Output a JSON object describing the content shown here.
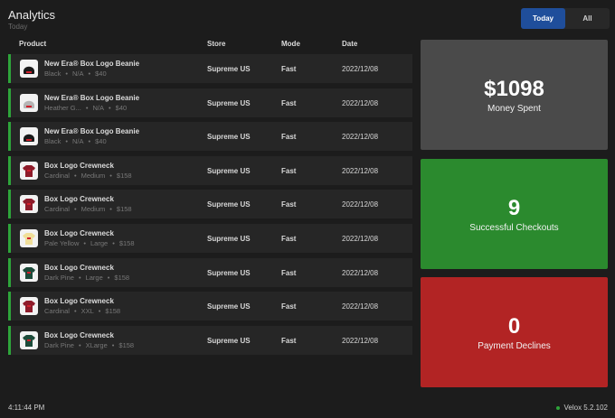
{
  "header": {
    "title": "Analytics",
    "subtitle": "Today"
  },
  "tabs": [
    {
      "label": "Today",
      "active": true
    },
    {
      "label": "All",
      "active": false
    }
  ],
  "table": {
    "columns": {
      "product": "Product",
      "store": "Store",
      "mode": "Mode",
      "date": "Date"
    },
    "rows": [
      {
        "name": "New Era® Box Logo Beanie",
        "color": "Black",
        "size": "N/A",
        "price": "$40",
        "store": "Supreme US",
        "mode": "Fast",
        "date": "2022/12/08",
        "icon": "beanie-icon",
        "swatch": "#1a1a1a"
      },
      {
        "name": "New Era® Box Logo Beanie",
        "color": "Heather G...",
        "size": "N/A",
        "price": "$40",
        "store": "Supreme US",
        "mode": "Fast",
        "date": "2022/12/08",
        "icon": "beanie-icon",
        "swatch": "#b5b5b5"
      },
      {
        "name": "New Era® Box Logo Beanie",
        "color": "Black",
        "size": "N/A",
        "price": "$40",
        "store": "Supreme US",
        "mode": "Fast",
        "date": "2022/12/08",
        "icon": "beanie-icon",
        "swatch": "#1a1a1a"
      },
      {
        "name": "Box Logo Crewneck",
        "color": "Cardinal",
        "size": "Medium",
        "price": "$158",
        "store": "Supreme US",
        "mode": "Fast",
        "date": "2022/12/08",
        "icon": "crewneck-icon",
        "swatch": "#8e1b2a"
      },
      {
        "name": "Box Logo Crewneck",
        "color": "Cardinal",
        "size": "Medium",
        "price": "$158",
        "store": "Supreme US",
        "mode": "Fast",
        "date": "2022/12/08",
        "icon": "crewneck-icon",
        "swatch": "#8e1b2a"
      },
      {
        "name": "Box Logo Crewneck",
        "color": "Pale Yellow",
        "size": "Large",
        "price": "$158",
        "store": "Supreme US",
        "mode": "Fast",
        "date": "2022/12/08",
        "icon": "crewneck-icon",
        "swatch": "#f0df9a"
      },
      {
        "name": "Box Logo Crewneck",
        "color": "Dark Pine",
        "size": "Large",
        "price": "$158",
        "store": "Supreme US",
        "mode": "Fast",
        "date": "2022/12/08",
        "icon": "crewneck-icon",
        "swatch": "#1d4b3a"
      },
      {
        "name": "Box Logo Crewneck",
        "color": "Cardinal",
        "size": "XXL",
        "price": "$158",
        "store": "Supreme US",
        "mode": "Fast",
        "date": "2022/12/08",
        "icon": "crewneck-icon",
        "swatch": "#8e1b2a"
      },
      {
        "name": "Box Logo Crewneck",
        "color": "Dark Pine",
        "size": "XLarge",
        "price": "$158",
        "store": "Supreme US",
        "mode": "Fast",
        "date": "2022/12/08",
        "icon": "crewneck-icon",
        "swatch": "#1d4b3a"
      }
    ]
  },
  "stats": [
    {
      "value": "$1098",
      "label": "Money Spent",
      "color": "#4a4a4a"
    },
    {
      "value": "9",
      "label": "Successful Checkouts",
      "color": "#2b8a2e"
    },
    {
      "value": "0",
      "label": "Payment Declines",
      "color": "#b22424"
    }
  ],
  "footer": {
    "time": "4:11:44 PM",
    "version": "Velox 5.2.102"
  },
  "colors": {
    "accent": "#1f4e9b",
    "success": "#2ea43a"
  }
}
